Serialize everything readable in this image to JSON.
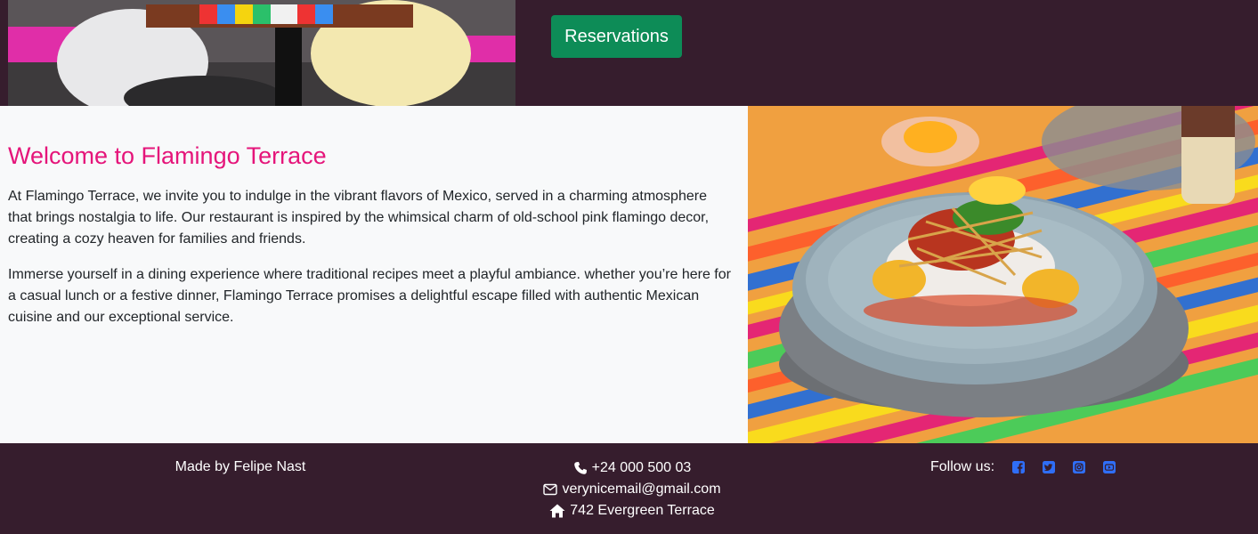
{
  "hero": {
    "reservations_label": "Reservations"
  },
  "welcome": {
    "title": "Welcome to Flamingo Terrace",
    "paragraph_1": "At Flamingo Terrace, we invite you to indulge in the vibrant flavors of Mexico, served in a charming atmosphere that brings nostalgia to life. Our restaurant is inspired by the whimsical charm of old-school pink flamingo decor, creating a cozy heaven for families and friends.",
    "paragraph_2": "Immerse yourself in a dining experience where traditional recipes meet a playful ambiance. whether you’re here for a casual lunch or a festive dinner, Flamingo Terrace promises a delightful escape filled with authentic Mexican cuisine and our exceptional service."
  },
  "footer": {
    "made_by": "Made by Felipe Nast",
    "phone": "+24 000 500 03",
    "email": "verynicemail@gmail.com",
    "address": "742 Evergreen Terrace",
    "follow_label": "Follow us:",
    "social_icons": [
      "facebook-icon",
      "twitter-icon",
      "instagram-icon",
      "youtube-icon"
    ]
  },
  "colors": {
    "brand_dark": "#361d2d",
    "accent_pink": "#e5157a",
    "button_green": "#0d8c57",
    "social_blue": "#2f6ef7"
  }
}
